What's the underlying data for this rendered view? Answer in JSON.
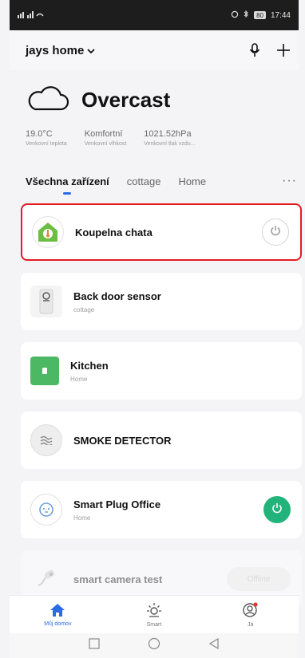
{
  "status_bar": {
    "signal_text": "⁴⁶ıl .ıl",
    "time": "17:44",
    "battery": "80"
  },
  "header": {
    "home_name": "jays home",
    "mic_icon": "microphone-icon",
    "add_icon": "plus-icon"
  },
  "weather": {
    "icon": "cloud-icon",
    "condition": "Overcast",
    "stats": [
      {
        "value": "19.0°C",
        "label": "Venkovní teplota"
      },
      {
        "value": "Komfortní",
        "label": "Venkovní vlhkost"
      },
      {
        "value": "1021.52hPa",
        "label": "Venkovní tlak vzdu..."
      }
    ]
  },
  "tabs": [
    {
      "label": "Všechna zařízení",
      "active": true
    },
    {
      "label": "cottage",
      "active": false
    },
    {
      "label": "Home",
      "active": false
    }
  ],
  "tabs_more": "···",
  "devices": [
    {
      "name": "Koupelna chata",
      "sub": "",
      "icon": "thermostat-icon",
      "power": "off",
      "selected": true
    },
    {
      "name": "Back door sensor",
      "sub": "cottage",
      "icon": "door-sensor-icon",
      "power": "",
      "selected": false
    },
    {
      "name": "Kitchen",
      "sub": "Home",
      "icon": "switch-icon",
      "power": "",
      "selected": false
    },
    {
      "name": "SMOKE DETECTOR",
      "sub": "",
      "icon": "smoke-detector-icon",
      "power": "",
      "selected": false
    },
    {
      "name": "Smart Plug Office",
      "sub": "Home",
      "icon": "plug-icon",
      "power": "on",
      "selected": false
    },
    {
      "name": "smart camera test",
      "sub": "",
      "icon": "camera-icon",
      "power": "offline",
      "selected": false
    }
  ],
  "offline_label": "Offline",
  "bottom_nav": [
    {
      "label": "Můj domov",
      "icon": "home-icon",
      "active": true
    },
    {
      "label": "Smart",
      "icon": "sun-icon",
      "active": false
    },
    {
      "label": "Já",
      "icon": "profile-icon",
      "active": false
    }
  ],
  "colors": {
    "accent": "#2b6be6",
    "power_on": "#22b37b",
    "selection": "#e31b23"
  }
}
